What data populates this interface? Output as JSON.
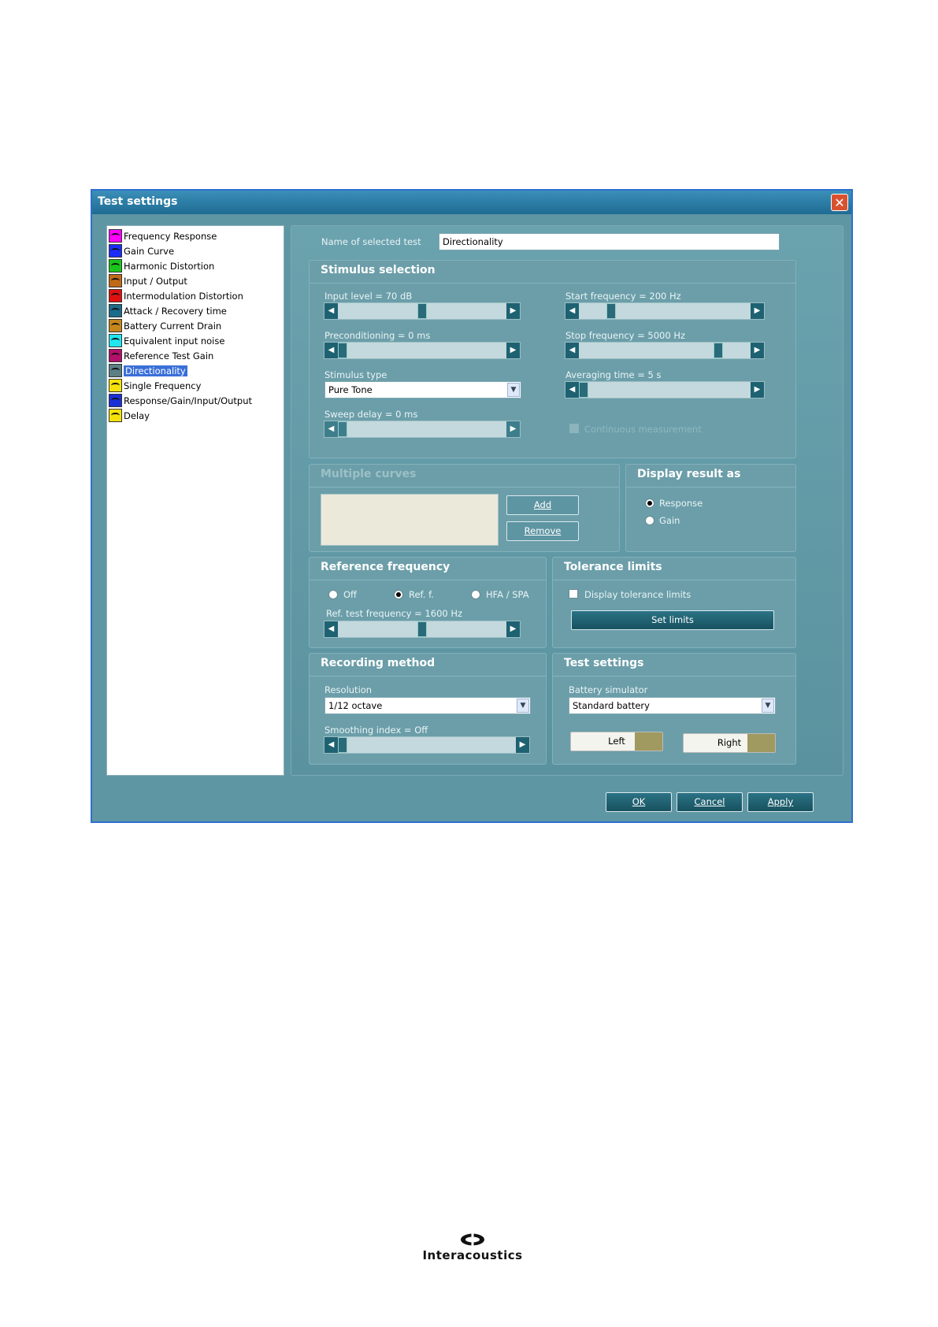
{
  "window": {
    "title": "Test settings"
  },
  "test_list": [
    {
      "label": "Frequency Response",
      "color": "#ff00ff"
    },
    {
      "label": "Gain Curve",
      "color": "#1c2cff"
    },
    {
      "label": "Harmonic Distortion",
      "color": "#19c51a"
    },
    {
      "label": "Input / Output",
      "color": "#c06a16"
    },
    {
      "label": "Intermodulation Distortion",
      "color": "#e01010"
    },
    {
      "label": "Attack / Recovery time",
      "color": "#1b6b8a"
    },
    {
      "label": "Battery Current Drain",
      "color": "#c6861a"
    },
    {
      "label": "Equivalent input noise",
      "color": "#20e6f0"
    },
    {
      "label": "Reference Test Gain",
      "color": "#b40f6a"
    },
    {
      "label": "Directionality",
      "color": "#5c7f86",
      "selected": true
    },
    {
      "label": "Single Frequency",
      "color": "#f5e20a"
    },
    {
      "label": "Response/Gain/Input/Output",
      "color": "#1930d8"
    },
    {
      "label": "Delay",
      "color": "#f5e20a"
    }
  ],
  "name_field": {
    "label": "Name of selected test",
    "value": "Directionality"
  },
  "stimulus": {
    "title": "Stimulus selection",
    "input_level": {
      "label": "Input level = 70 dB",
      "position": 0.5
    },
    "preconditioning": {
      "label": "Preconditioning = 0 ms",
      "position": 0
    },
    "stimulus_type": {
      "label": "Stimulus type",
      "value": "Pure Tone"
    },
    "sweep_delay": {
      "label": "Sweep delay = 0 ms",
      "position": 0
    },
    "start_frequency": {
      "label": "Start frequency = 200 Hz",
      "position": 0.17
    },
    "stop_frequency": {
      "label": "Stop frequency = 5000 Hz",
      "position": 0.83
    },
    "averaging_time": {
      "label": "Averaging time = 5 s",
      "position": 0
    },
    "continuous": {
      "label": "Continuous measurement",
      "checked": false
    }
  },
  "multiple_curves": {
    "title": "Multiple curves",
    "add": "Add",
    "remove": "Remove"
  },
  "display_result": {
    "title": "Display result as",
    "options": [
      "Response",
      "Gain"
    ],
    "selected": "Response"
  },
  "reference_frequency": {
    "title": "Reference frequency",
    "options": [
      "Off",
      "Ref. f.",
      "HFA / SPA"
    ],
    "selected": "Ref. f.",
    "ref_test": {
      "label": "Ref. test frequency = 1600 Hz",
      "position": 0.5
    }
  },
  "tolerance": {
    "title": "Tolerance limits",
    "display_label": "Display tolerance limits",
    "checked": false,
    "set_limits": "Set limits"
  },
  "recording": {
    "title": "Recording method",
    "resolution_label": "Resolution",
    "resolution": "1/12 octave",
    "smoothing": {
      "label": "Smoothing index = Off",
      "position": 0
    }
  },
  "test_settings": {
    "title": "Test settings",
    "battery_label": "Battery simulator",
    "battery": "Standard battery",
    "left": "Left",
    "right": "Right"
  },
  "footer": {
    "ok": "OK",
    "cancel": "Cancel",
    "apply": "Apply"
  },
  "brand": {
    "name": "Interacoustics"
  }
}
